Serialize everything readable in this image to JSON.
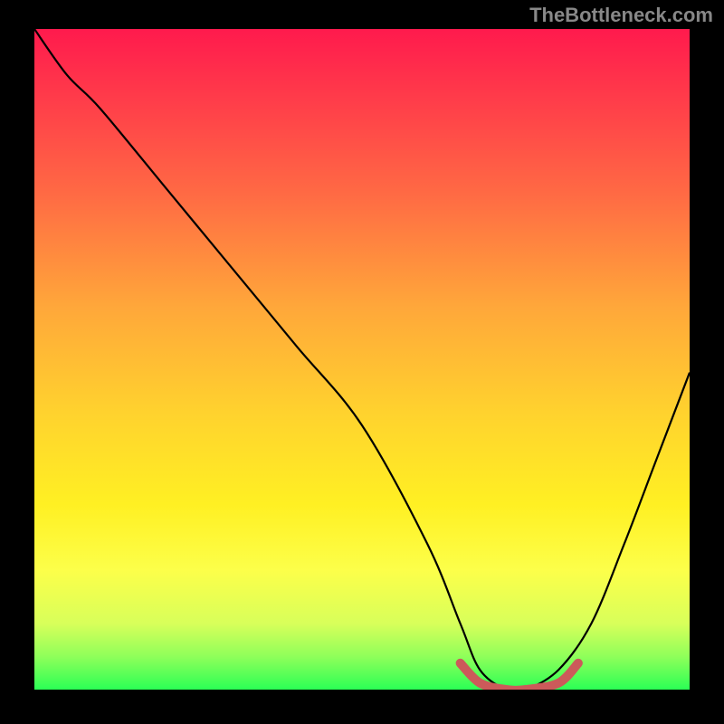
{
  "attribution": "TheBottleneck.com",
  "chart_data": {
    "type": "line",
    "title": "",
    "xlabel": "",
    "ylabel": "",
    "xlim": [
      0,
      100
    ],
    "ylim": [
      0,
      100
    ],
    "series": [
      {
        "name": "bottleneck-curve",
        "color": "#000000",
        "x": [
          0,
          5,
          10,
          20,
          30,
          40,
          50,
          60,
          65,
          68,
          72,
          75,
          80,
          85,
          90,
          95,
          100
        ],
        "y": [
          100,
          93,
          88,
          76,
          64,
          52,
          40,
          22,
          10,
          3,
          0,
          0,
          3,
          10,
          22,
          35,
          48
        ]
      },
      {
        "name": "optimal-range-marker",
        "color": "#cc5a5a",
        "x": [
          65,
          68,
          72,
          75,
          80,
          83
        ],
        "y": [
          4,
          1,
          0,
          0,
          1,
          4
        ]
      }
    ],
    "description": "V-shaped bottleneck curve over a red-to-green heat gradient; the minimum (optimal zone) sits around x≈70–80 where the curve touches the green band, marked by a dusty-red stroke."
  }
}
